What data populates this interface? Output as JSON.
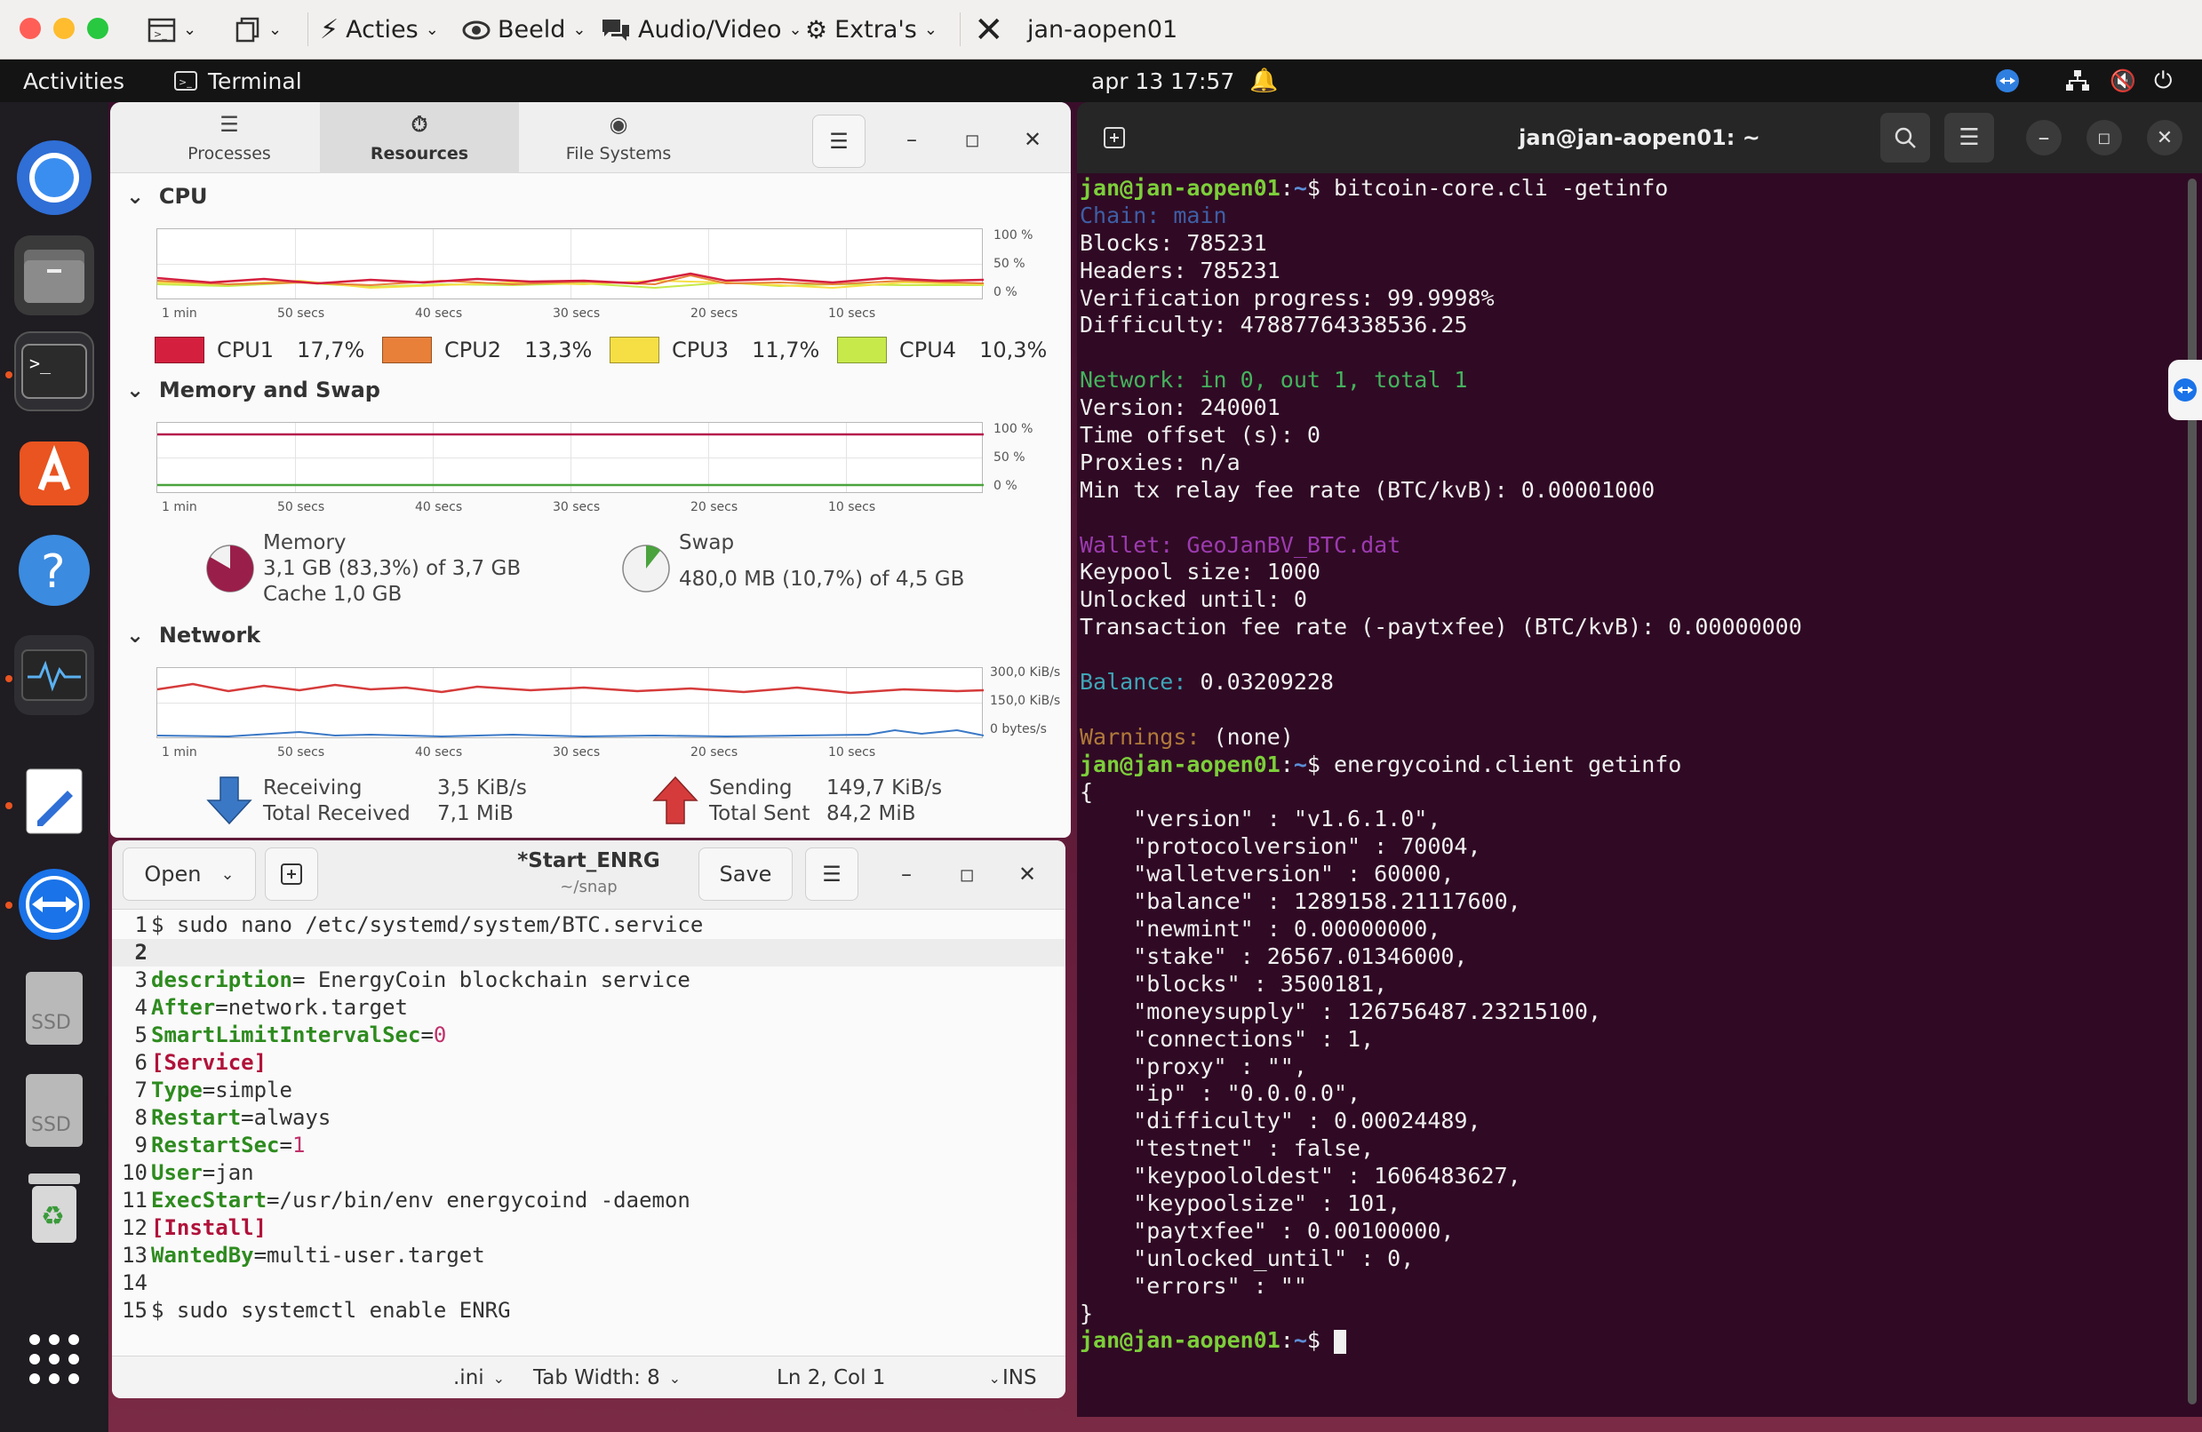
{
  "mac_bar": {
    "menus": [
      {
        "icon": "flash-icon",
        "label": "Acties"
      },
      {
        "icon": "eye-icon",
        "label": "Beeld"
      },
      {
        "icon": "chat-icon",
        "label": "Audio/Video"
      },
      {
        "icon": "puzzle-icon",
        "label": "Extra's"
      }
    ],
    "session_title": "jan-aopen01"
  },
  "gnome_bar": {
    "activities": "Activities",
    "app": "Terminal",
    "datetime": "apr 13  17:57"
  },
  "sysmon": {
    "tabs": [
      "Processes",
      "Resources",
      "File Systems"
    ],
    "cpu": {
      "title": "CPU",
      "y_labels": [
        "100 %",
        "50 %",
        "0 %"
      ],
      "x_labels": [
        "1 min",
        "50 secs",
        "40 secs",
        "30 secs",
        "20 secs",
        "10 secs"
      ],
      "legend": [
        {
          "name": "CPU1",
          "value": "17,7%",
          "color": "#d41f3f"
        },
        {
          "name": "CPU2",
          "value": "13,3%",
          "color": "#e8803a"
        },
        {
          "name": "CPU3",
          "value": "11,7%",
          "color": "#f6df45"
        },
        {
          "name": "CPU4",
          "value": "10,3%",
          "color": "#c7e94a"
        }
      ]
    },
    "memory": {
      "title": "Memory and Swap",
      "y_labels": [
        "100 %",
        "50 %",
        "0 %"
      ],
      "x_labels": [
        "1 min",
        "50 secs",
        "40 secs",
        "30 secs",
        "20 secs",
        "10 secs"
      ],
      "mem_label": "Memory",
      "mem_value": "3,1 GB (83,3%) of 3,7 GB",
      "mem_cache": "Cache 1,0 GB",
      "mem_fraction": 0.833,
      "swap_label": "Swap",
      "swap_value": "480,0 MB (10,7%) of 4,5 GB",
      "swap_fraction": 0.107
    },
    "network": {
      "title": "Network",
      "y_labels": [
        "300,0 KiB/s",
        "150,0 KiB/s",
        "0 bytes/s"
      ],
      "x_labels": [
        "1 min",
        "50 secs",
        "40 secs",
        "30 secs",
        "20 secs",
        "10 secs"
      ],
      "recv_label": "Receiving",
      "recv_value": "3,5 KiB/s",
      "recv_total_label": "Total Received",
      "recv_total": "7,1 MiB",
      "send_label": "Sending",
      "send_value": "149,7 KiB/s",
      "send_total_label": "Total Sent",
      "send_total": "84,2 MiB"
    }
  },
  "editor": {
    "open_label": "Open",
    "title": "*Start_ENRG",
    "subtitle": "~/snap",
    "save_label": "Save",
    "status": {
      "lang": ".ini",
      "tab": "Tab Width: 8",
      "pos": "Ln 2, Col 1",
      "mode": "INS"
    },
    "lines": [
      {
        "n": "1",
        "parts": [
          {
            "t": "$ sudo nano /etc/systemd/system/BTC.service",
            "c": ""
          }
        ]
      },
      {
        "n": "2",
        "parts": []
      },
      {
        "n": "3",
        "parts": [
          {
            "t": "description",
            "c": "k"
          },
          {
            "t": "= EnergyCoin blockchain service",
            "c": ""
          }
        ]
      },
      {
        "n": "4",
        "parts": [
          {
            "t": "After",
            "c": "k"
          },
          {
            "t": "=network.target",
            "c": ""
          }
        ]
      },
      {
        "n": "5",
        "parts": [
          {
            "t": "SmartLimitIntervalSec",
            "c": "k"
          },
          {
            "t": "=",
            "c": ""
          },
          {
            "t": "0",
            "c": "n"
          }
        ]
      },
      {
        "n": "6",
        "parts": [
          {
            "t": "[Service]",
            "c": "s"
          }
        ]
      },
      {
        "n": "7",
        "parts": [
          {
            "t": "Type",
            "c": "k"
          },
          {
            "t": "=simple",
            "c": ""
          }
        ]
      },
      {
        "n": "8",
        "parts": [
          {
            "t": "Restart",
            "c": "k"
          },
          {
            "t": "=always",
            "c": ""
          }
        ]
      },
      {
        "n": "9",
        "parts": [
          {
            "t": "RestartSec",
            "c": "k"
          },
          {
            "t": "=",
            "c": ""
          },
          {
            "t": "1",
            "c": "n"
          }
        ]
      },
      {
        "n": "10",
        "parts": [
          {
            "t": "User",
            "c": "k"
          },
          {
            "t": "=jan",
            "c": ""
          }
        ]
      },
      {
        "n": "11",
        "parts": [
          {
            "t": "ExecStart",
            "c": "k"
          },
          {
            "t": "=/usr/bin/env energycoind -daemon",
            "c": ""
          }
        ]
      },
      {
        "n": "12",
        "parts": [
          {
            "t": "[Install]",
            "c": "s"
          }
        ]
      },
      {
        "n": "13",
        "parts": [
          {
            "t": "WantedBy",
            "c": "k"
          },
          {
            "t": "=multi-user.target",
            "c": ""
          }
        ]
      },
      {
        "n": "14",
        "parts": []
      },
      {
        "n": "15",
        "parts": [
          {
            "t": "$ sudo systemctl enable ENRG",
            "c": ""
          }
        ]
      }
    ]
  },
  "terminal": {
    "title": "jan@jan-aopen01: ~",
    "colors": {
      "prompt": "#7ccf3a",
      "path": "#5b8fd8",
      "chain": "#3e5fa6",
      "network": "#44b35d",
      "wallet": "#9c3bb0",
      "balance": "#3ea6b8",
      "warnings": "#b07a3a"
    },
    "lines": [
      {
        "parts": [
          {
            "t": "jan@jan-aopen01",
            "c": "prompt"
          },
          {
            "t": ":",
            "c": ""
          },
          {
            "t": "~",
            "c": "path"
          },
          {
            "t": "$ bitcoin-core.cli -getinfo",
            "c": ""
          }
        ]
      },
      {
        "parts": [
          {
            "t": "Chain: main",
            "c": "chain"
          }
        ]
      },
      {
        "parts": [
          {
            "t": "Blocks: 785231",
            "c": ""
          }
        ]
      },
      {
        "parts": [
          {
            "t": "Headers: 785231",
            "c": ""
          }
        ]
      },
      {
        "parts": [
          {
            "t": "Verification progress: 99.9998%",
            "c": ""
          }
        ]
      },
      {
        "parts": [
          {
            "t": "Difficulty: 47887764338536.25",
            "c": ""
          }
        ]
      },
      {
        "parts": []
      },
      {
        "parts": [
          {
            "t": "Network: in 0, out 1, total 1",
            "c": "network"
          }
        ]
      },
      {
        "parts": [
          {
            "t": "Version: 240001",
            "c": ""
          }
        ]
      },
      {
        "parts": [
          {
            "t": "Time offset (s): 0",
            "c": ""
          }
        ]
      },
      {
        "parts": [
          {
            "t": "Proxies: n/a",
            "c": ""
          }
        ]
      },
      {
        "parts": [
          {
            "t": "Min tx relay fee rate (BTC/kvB): 0.00001000",
            "c": ""
          }
        ]
      },
      {
        "parts": []
      },
      {
        "parts": [
          {
            "t": "Wallet: GeoJanBV_BTC.dat",
            "c": "wallet"
          }
        ]
      },
      {
        "parts": [
          {
            "t": "Keypool size: 1000",
            "c": ""
          }
        ]
      },
      {
        "parts": [
          {
            "t": "Unlocked until: 0",
            "c": ""
          }
        ]
      },
      {
        "parts": [
          {
            "t": "Transaction fee rate (-paytxfee) (BTC/kvB): 0.00000000",
            "c": ""
          }
        ]
      },
      {
        "parts": []
      },
      {
        "parts": [
          {
            "t": "Balance:",
            "c": "balance"
          },
          {
            "t": " 0.03209228",
            "c": ""
          }
        ]
      },
      {
        "parts": []
      },
      {
        "parts": [
          {
            "t": "Warnings:",
            "c": "warnings"
          },
          {
            "t": " (none)",
            "c": ""
          }
        ]
      },
      {
        "parts": [
          {
            "t": "jan@jan-aopen01",
            "c": "prompt"
          },
          {
            "t": ":",
            "c": ""
          },
          {
            "t": "~",
            "c": "path"
          },
          {
            "t": "$ energycoind.client getinfo",
            "c": ""
          }
        ]
      },
      {
        "parts": [
          {
            "t": "{",
            "c": ""
          }
        ]
      },
      {
        "parts": [
          {
            "t": "    \"version\" : \"v1.6.1.0\",",
            "c": ""
          }
        ]
      },
      {
        "parts": [
          {
            "t": "    \"protocolversion\" : 70004,",
            "c": ""
          }
        ]
      },
      {
        "parts": [
          {
            "t": "    \"walletversion\" : 60000,",
            "c": ""
          }
        ]
      },
      {
        "parts": [
          {
            "t": "    \"balance\" : 1289158.21117600,",
            "c": ""
          }
        ]
      },
      {
        "parts": [
          {
            "t": "    \"newmint\" : 0.00000000,",
            "c": ""
          }
        ]
      },
      {
        "parts": [
          {
            "t": "    \"stake\" : 26567.01346000,",
            "c": ""
          }
        ]
      },
      {
        "parts": [
          {
            "t": "    \"blocks\" : 3500181,",
            "c": ""
          }
        ]
      },
      {
        "parts": [
          {
            "t": "    \"moneysupply\" : 126756487.23215100,",
            "c": ""
          }
        ]
      },
      {
        "parts": [
          {
            "t": "    \"connections\" : 1,",
            "c": ""
          }
        ]
      },
      {
        "parts": [
          {
            "t": "    \"proxy\" : \"\",",
            "c": ""
          }
        ]
      },
      {
        "parts": [
          {
            "t": "    \"ip\" : \"0.0.0.0\",",
            "c": ""
          }
        ]
      },
      {
        "parts": [
          {
            "t": "    \"difficulty\" : 0.00024489,",
            "c": ""
          }
        ]
      },
      {
        "parts": [
          {
            "t": "    \"testnet\" : false,",
            "c": ""
          }
        ]
      },
      {
        "parts": [
          {
            "t": "    \"keypoololdest\" : 1606483627,",
            "c": ""
          }
        ]
      },
      {
        "parts": [
          {
            "t": "    \"keypoolsize\" : 101,",
            "c": ""
          }
        ]
      },
      {
        "parts": [
          {
            "t": "    \"paytxfee\" : 0.00100000,",
            "c": ""
          }
        ]
      },
      {
        "parts": [
          {
            "t": "    \"unlocked_until\" : 0,",
            "c": ""
          }
        ]
      },
      {
        "parts": [
          {
            "t": "    \"errors\" : \"\"",
            "c": ""
          }
        ]
      },
      {
        "parts": [
          {
            "t": "}",
            "c": ""
          }
        ]
      },
      {
        "parts": [
          {
            "t": "jan@jan-aopen01",
            "c": "prompt"
          },
          {
            "t": ":",
            "c": ""
          },
          {
            "t": "~",
            "c": "path"
          },
          {
            "t": "$ ",
            "c": ""
          }
        ],
        "cursor": true
      }
    ]
  },
  "dock": {
    "items": [
      {
        "name": "chromium-icon"
      },
      {
        "name": "files-icon"
      },
      {
        "name": "terminal-icon"
      },
      {
        "name": "app-center-icon"
      },
      {
        "name": "help-icon"
      },
      {
        "name": "system-monitor-icon"
      },
      {
        "name": "text-editor-icon"
      },
      {
        "name": "teamviewer-icon"
      },
      {
        "name": "ssd-drive-icon"
      },
      {
        "name": "ssd-drive-icon"
      },
      {
        "name": "trash-icon"
      },
      {
        "name": "show-apps-icon"
      }
    ],
    "ssd_label": "SSD"
  }
}
